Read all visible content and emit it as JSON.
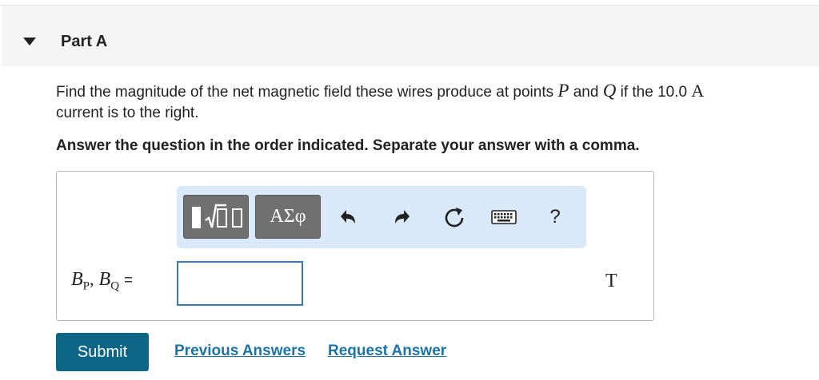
{
  "part": {
    "title": "Part A"
  },
  "question": {
    "text_before_p": "Find the magnitude of the net magnetic field these wires produce at points",
    "point_p": "P",
    "and_text": "and",
    "point_q": "Q",
    "text_if": "if the 10.0",
    "current_unit": "A",
    "text_end": "current is to the right."
  },
  "instruction": "Answer the question in the order indicated. Separate your answer with a comma.",
  "toolbar": {
    "symbols_label": "ΑΣφ",
    "help_label": "?",
    "icons": [
      "templates-icon",
      "symbols-icon",
      "undo-icon",
      "redo-icon",
      "reset-icon",
      "keyboard-icon",
      "help-icon"
    ]
  },
  "answer": {
    "lhs_var1": "B",
    "lhs_sub1": "P",
    "separator": ",",
    "lhs_var2": "B",
    "lhs_sub2": "Q",
    "equals": "=",
    "value": "",
    "units": "T"
  },
  "buttons": {
    "submit": "Submit",
    "previous_answers": "Previous Answers",
    "request_answer": "Request Answer"
  },
  "colors": {
    "toolbar_bg": "#d9e9f9",
    "submit_bg": "#0e6686",
    "link": "#1b73a6",
    "input_border": "#3a78b8"
  }
}
